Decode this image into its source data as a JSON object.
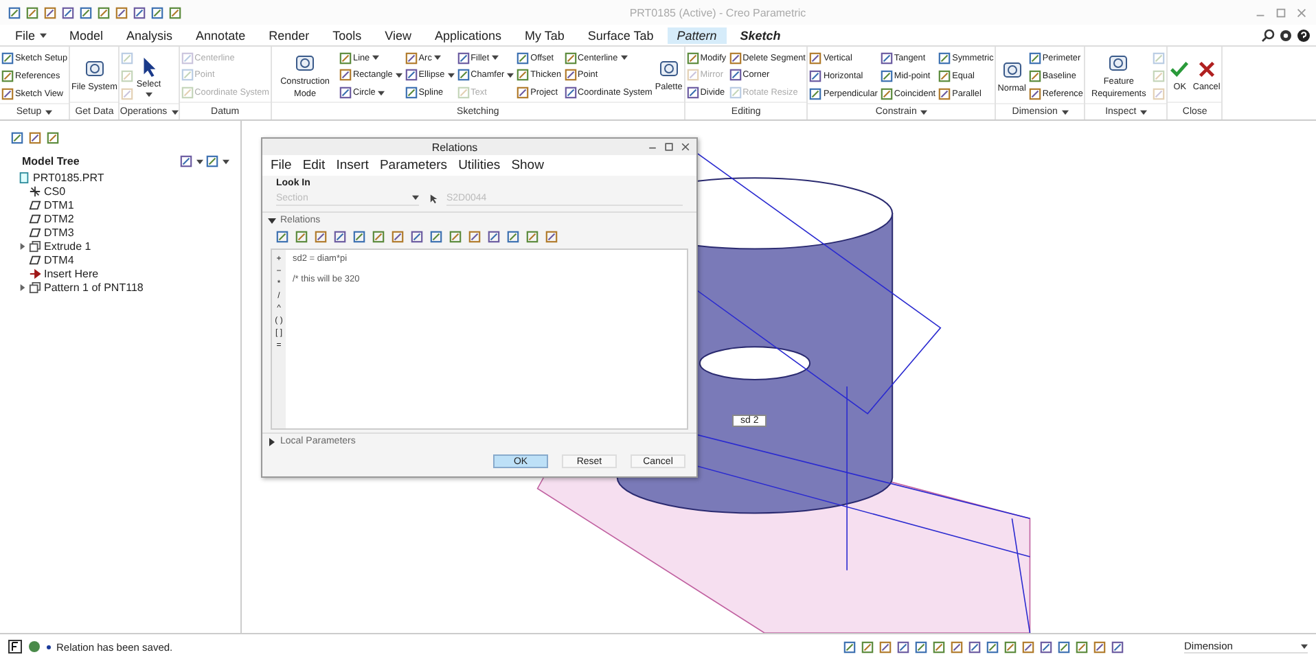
{
  "window": {
    "title": "PRT0185 (Active) - Creo Parametric"
  },
  "tabs": [
    {
      "label": "File",
      "selected": false,
      "contextual": false,
      "dropdown": true
    },
    {
      "label": "Model",
      "selected": false,
      "contextual": false,
      "dropdown": false
    },
    {
      "label": "Analysis",
      "selected": false,
      "contextual": false,
      "dropdown": false
    },
    {
      "label": "Annotate",
      "selected": false,
      "contextual": false,
      "dropdown": false
    },
    {
      "label": "Render",
      "selected": false,
      "contextual": false,
      "dropdown": false
    },
    {
      "label": "Tools",
      "selected": false,
      "contextual": false,
      "dropdown": false
    },
    {
      "label": "View",
      "selected": false,
      "contextual": false,
      "dropdown": false
    },
    {
      "label": "Applications",
      "selected": false,
      "contextual": false,
      "dropdown": false
    },
    {
      "label": "My Tab",
      "selected": false,
      "contextual": false,
      "dropdown": false
    },
    {
      "label": "Surface Tab",
      "selected": false,
      "contextual": false,
      "dropdown": false
    },
    {
      "label": "Pattern",
      "selected": false,
      "contextual": true,
      "dropdown": false
    },
    {
      "label": "Sketch",
      "selected": true,
      "contextual": true,
      "dropdown": false
    }
  ],
  "ribbon": [
    {
      "label": "Setup",
      "dropdown": true,
      "columns": [
        {
          "kind": "small",
          "items": [
            {
              "label": "Sketch Setup",
              "disabled": false,
              "dropdown": false
            },
            {
              "label": "References",
              "disabled": false,
              "dropdown": false
            },
            {
              "label": "Sketch View",
              "disabled": false,
              "dropdown": false
            }
          ]
        }
      ]
    },
    {
      "label": "Get Data",
      "dropdown": false,
      "columns": [
        {
          "kind": "large",
          "items": [
            {
              "label": "File System",
              "disabled": false,
              "dropdown": false
            }
          ]
        }
      ]
    },
    {
      "label": "Operations",
      "dropdown": true,
      "columns": [
        {
          "kind": "icons",
          "items": [
            {
              "disabled": true
            },
            {
              "disabled": true
            },
            {
              "disabled": true
            }
          ]
        },
        {
          "kind": "select",
          "items": [
            {
              "label": "Select",
              "disabled": false,
              "dropdown": true
            }
          ]
        }
      ]
    },
    {
      "label": "Datum",
      "dropdown": false,
      "columns": [
        {
          "kind": "small",
          "items": [
            {
              "label": "Centerline",
              "disabled": true,
              "dropdown": false
            },
            {
              "label": "Point",
              "disabled": true,
              "dropdown": false
            },
            {
              "label": "Coordinate System",
              "disabled": true,
              "dropdown": false
            }
          ]
        }
      ]
    },
    {
      "label": "Sketching",
      "dropdown": false,
      "columns": [
        {
          "kind": "large",
          "items": [
            {
              "label": "Construction Mode",
              "disabled": false,
              "dropdown": false
            }
          ]
        },
        {
          "kind": "small",
          "items": [
            {
              "label": "Line",
              "disabled": false,
              "dropdown": true
            },
            {
              "label": "Rectangle",
              "disabled": false,
              "dropdown": true
            },
            {
              "label": "Circle",
              "disabled": false,
              "dropdown": true
            }
          ]
        },
        {
          "kind": "small",
          "items": [
            {
              "label": "Arc",
              "disabled": false,
              "dropdown": true
            },
            {
              "label": "Ellipse",
              "disabled": false,
              "dropdown": true
            },
            {
              "label": "Spline",
              "disabled": false,
              "dropdown": false
            }
          ]
        },
        {
          "kind": "small",
          "items": [
            {
              "label": "Fillet",
              "disabled": false,
              "dropdown": true
            },
            {
              "label": "Chamfer",
              "disabled": false,
              "dropdown": true
            },
            {
              "label": "Text",
              "disabled": true,
              "dropdown": false
            }
          ]
        },
        {
          "kind": "small",
          "items": [
            {
              "label": "Offset",
              "disabled": false,
              "dropdown": false
            },
            {
              "label": "Thicken",
              "disabled": false,
              "dropdown": false
            },
            {
              "label": "Project",
              "disabled": false,
              "dropdown": false
            }
          ]
        },
        {
          "kind": "small",
          "items": [
            {
              "label": "Centerline",
              "disabled": false,
              "dropdown": true
            },
            {
              "label": "Point",
              "disabled": false,
              "dropdown": false
            },
            {
              "label": "Coordinate System",
              "disabled": false,
              "dropdown": false
            }
          ]
        },
        {
          "kind": "large",
          "items": [
            {
              "label": "Palette",
              "disabled": false,
              "dropdown": false
            }
          ]
        }
      ]
    },
    {
      "label": "Editing",
      "dropdown": false,
      "columns": [
        {
          "kind": "small",
          "items": [
            {
              "label": "Modify",
              "disabled": false,
              "dropdown": false
            },
            {
              "label": "Mirror",
              "disabled": true,
              "dropdown": false
            },
            {
              "label": "Divide",
              "disabled": false,
              "dropdown": false
            }
          ]
        },
        {
          "kind": "small",
          "items": [
            {
              "label": "Delete Segment",
              "disabled": false,
              "dropdown": false
            },
            {
              "label": "Corner",
              "disabled": false,
              "dropdown": false
            },
            {
              "label": "Rotate Resize",
              "disabled": true,
              "dropdown": false
            }
          ]
        }
      ]
    },
    {
      "label": "Constrain",
      "dropdown": true,
      "columns": [
        {
          "kind": "small",
          "items": [
            {
              "label": "Vertical",
              "disabled": false,
              "dropdown": false
            },
            {
              "label": "Horizontal",
              "disabled": false,
              "dropdown": false
            },
            {
              "label": "Perpendicular",
              "disabled": false,
              "dropdown": false
            }
          ]
        },
        {
          "kind": "small",
          "items": [
            {
              "label": "Tangent",
              "disabled": false,
              "dropdown": false
            },
            {
              "label": "Mid-point",
              "disabled": false,
              "dropdown": false
            },
            {
              "label": "Coincident",
              "disabled": false,
              "dropdown": false
            }
          ]
        },
        {
          "kind": "small",
          "items": [
            {
              "label": "Symmetric",
              "disabled": false,
              "dropdown": false
            },
            {
              "label": "Equal",
              "disabled": false,
              "dropdown": false
            },
            {
              "label": "Parallel",
              "disabled": false,
              "dropdown": false
            }
          ]
        }
      ]
    },
    {
      "label": "Dimension",
      "dropdown": true,
      "columns": [
        {
          "kind": "large",
          "items": [
            {
              "label": "Normal",
              "disabled": false,
              "dropdown": false
            }
          ]
        },
        {
          "kind": "small",
          "items": [
            {
              "label": "Perimeter",
              "disabled": false,
              "dropdown": false
            },
            {
              "label": "Baseline",
              "disabled": false,
              "dropdown": false
            },
            {
              "label": "Reference",
              "disabled": false,
              "dropdown": false
            }
          ]
        }
      ]
    },
    {
      "label": "Inspect",
      "dropdown": true,
      "columns": [
        {
          "kind": "large",
          "items": [
            {
              "label": "Feature Requirements",
              "disabled": false,
              "dropdown": false
            }
          ]
        },
        {
          "kind": "icons",
          "items": [
            {
              "disabled": true
            },
            {
              "disabled": true
            },
            {
              "disabled": true
            }
          ]
        }
      ]
    },
    {
      "label": "Close",
      "dropdown": false,
      "columns": [
        {
          "kind": "ok",
          "items": [
            {
              "label": "OK",
              "disabled": false,
              "dropdown": false
            }
          ]
        },
        {
          "kind": "cancel",
          "items": [
            {
              "label": "Cancel",
              "disabled": false,
              "dropdown": false
            }
          ]
        }
      ]
    }
  ],
  "model_tree": {
    "title": "Model Tree",
    "items": [
      {
        "label": "PRT0185.PRT",
        "kind": "part",
        "children": [
          {
            "label": "CS0",
            "kind": "csys"
          },
          {
            "label": "DTM1",
            "kind": "plane"
          },
          {
            "label": "DTM2",
            "kind": "plane"
          },
          {
            "label": "DTM3",
            "kind": "plane"
          },
          {
            "label": "Extrude 1",
            "kind": "feature",
            "expanded": false
          },
          {
            "label": "DTM4",
            "kind": "plane"
          },
          {
            "label": "Insert Here",
            "kind": "insert"
          },
          {
            "label": "Pattern 1 of PNT118",
            "kind": "feature",
            "expanded": false
          }
        ]
      }
    ]
  },
  "graphics": {
    "dimension_label": "sd 2"
  },
  "dialog": {
    "title": "Relations",
    "menu": [
      "File",
      "Edit",
      "Insert",
      "Parameters",
      "Utilities",
      "Show"
    ],
    "look_in": {
      "label": "Look In",
      "type_value": "Section",
      "object_value": "S2D0044"
    },
    "relations": {
      "label": "Relations",
      "expanded": true,
      "operators": [
        "+",
        "−",
        "*",
        "/",
        "^",
        "( )",
        "[ ]",
        "="
      ],
      "lines": [
        "sd2 = diam*pi",
        "/* this will be 320"
      ]
    },
    "local_parameters": {
      "label": "Local Parameters",
      "expanded": false
    },
    "buttons": [
      {
        "label": "OK",
        "kind": "primary"
      },
      {
        "label": "Reset",
        "kind": "normal"
      },
      {
        "label": "Cancel",
        "kind": "normal"
      }
    ]
  },
  "status_bar": {
    "message": "Relation has been saved.",
    "filter": "Dimension"
  }
}
